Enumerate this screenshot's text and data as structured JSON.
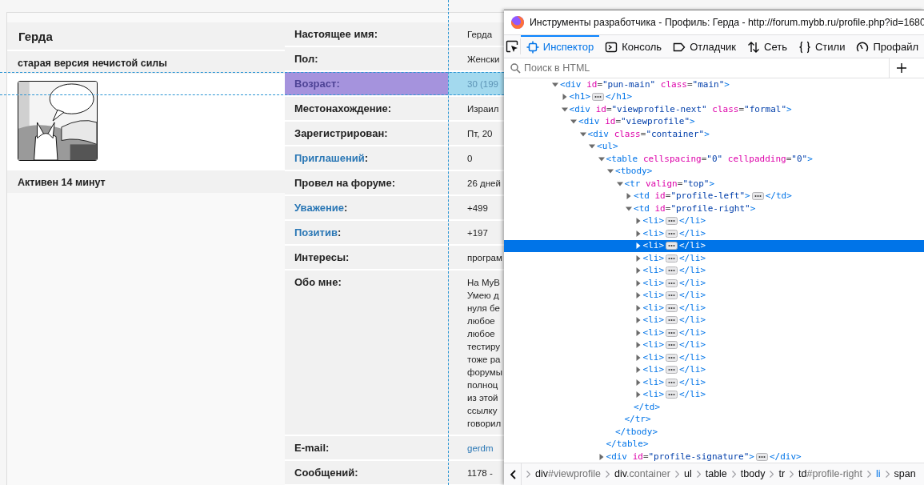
{
  "profile": {
    "username": "Герда",
    "user_title": "старая версия нечистой силы",
    "activity": "Активен 14 минут",
    "fields": [
      {
        "label": "Настоящее имя:",
        "link": false,
        "value": "Герда",
        "value_link": false,
        "highlighted": false
      },
      {
        "label": "Пол:",
        "link": false,
        "value": "Женски",
        "value_link": false,
        "highlighted": false
      },
      {
        "label": "Возраст:",
        "link": false,
        "value": "30 (199",
        "value_link": false,
        "highlighted": true
      },
      {
        "label": "Местонахождение:",
        "link": false,
        "value": "Израил",
        "value_link": false,
        "highlighted": false
      },
      {
        "label": "Зарегистрирован:",
        "link": false,
        "value": "Пт, 20",
        "value_link": false,
        "highlighted": false
      },
      {
        "label": "Приглашений",
        "after": ":",
        "link": true,
        "value": "0",
        "value_link": false,
        "highlighted": false
      },
      {
        "label": "Провел на форуме:",
        "link": false,
        "value": "26 дней",
        "value_link": false,
        "highlighted": false
      },
      {
        "label": "Уважение",
        "after": ":",
        "link": true,
        "value": "+499",
        "value_link": false,
        "highlighted": false
      },
      {
        "label": "Позитив",
        "after": ":",
        "link": true,
        "value": "+197",
        "value_link": false,
        "highlighted": false
      },
      {
        "label": "Интересы:",
        "link": false,
        "value": "програм",
        "value_link": false,
        "highlighted": false
      },
      {
        "label": "Обо мне:",
        "link": false,
        "lines": [
          "На MyB",
          "Умею д",
          "нуля бе",
          "любое",
          "любое",
          "тестиру",
          "тоже ра",
          "форумы",
          "полноц",
          "из этой",
          "ссылку",
          "говорил"
        ],
        "value_link": false,
        "highlighted": false
      },
      {
        "label": "E-mail:",
        "link": false,
        "value": "gerdm",
        "value_link": true,
        "highlighted": false
      },
      {
        "label": "Сообщений:",
        "link": false,
        "value": "1178 -",
        "value_link": false,
        "highlighted": false
      }
    ]
  },
  "devtools": {
    "title": "Инструменты разработчика - Профиль: Герда - http://forum.mybb.ru/profile.php?id=1680",
    "tabs": [
      {
        "label": "Инспектор",
        "kind": "inspector",
        "selected": true
      },
      {
        "label": "Консоль",
        "kind": "console",
        "selected": false
      },
      {
        "label": "Отладчик",
        "kind": "debugger",
        "selected": false
      },
      {
        "label": "Сеть",
        "kind": "network",
        "selected": false
      },
      {
        "label": "Стили",
        "kind": "style",
        "selected": false
      },
      {
        "label": "Профайл",
        "kind": "performance",
        "selected": false
      }
    ],
    "search": {
      "placeholder": "Поиск в HTML"
    },
    "tree": [
      {
        "open": "<div id=\"pun-main\" class=\"main\">",
        "expanded": true,
        "selected": false,
        "children": [
          {
            "open": "<h1>",
            "close": "</h1>",
            "expanded": false,
            "selected": false
          },
          {
            "open": "<div id=\"viewprofile-next\" class=\"formal\">",
            "expanded": true,
            "selected": false,
            "children": [
              {
                "open": "<div id=\"viewprofile\">",
                "expanded": true,
                "selected": false,
                "children": [
                  {
                    "open": "<div class=\"container\">",
                    "expanded": true,
                    "selected": false,
                    "children": [
                      {
                        "open": "<ul>",
                        "expanded": true,
                        "selected": false,
                        "children": [
                          {
                            "open": "<table cellspacing=\"0\" cellpadding=\"0\">",
                            "close": "</table>",
                            "expanded": true,
                            "selected": false,
                            "children": [
                              {
                                "open": "<tbody>",
                                "close": "</tbody>",
                                "expanded": true,
                                "selected": false,
                                "children": [
                                  {
                                    "open": "<tr valign=\"top\">",
                                    "close": "</tr>",
                                    "expanded": true,
                                    "selected": false,
                                    "children": [
                                      {
                                        "open": "<td id=\"profile-left\">",
                                        "close": "</td>",
                                        "expanded": false,
                                        "selected": false
                                      },
                                      {
                                        "open": "<td id=\"profile-right\">",
                                        "close": "</td>",
                                        "expanded": true,
                                        "selected": false,
                                        "children": [
                                          {
                                            "open": "<li>",
                                            "close": "</li>",
                                            "expanded": false,
                                            "selected": false
                                          },
                                          {
                                            "open": "<li>",
                                            "close": "</li>",
                                            "expanded": false,
                                            "selected": false
                                          },
                                          {
                                            "open": "<li>",
                                            "close": "</li>",
                                            "expanded": false,
                                            "selected": true
                                          },
                                          {
                                            "open": "<li>",
                                            "close": "</li>",
                                            "expanded": false,
                                            "selected": false
                                          },
                                          {
                                            "open": "<li>",
                                            "close": "</li>",
                                            "expanded": false,
                                            "selected": false
                                          },
                                          {
                                            "open": "<li>",
                                            "close": "</li>",
                                            "expanded": false,
                                            "selected": false
                                          },
                                          {
                                            "open": "<li>",
                                            "close": "</li>",
                                            "expanded": false,
                                            "selected": false
                                          },
                                          {
                                            "open": "<li>",
                                            "close": "</li>",
                                            "expanded": false,
                                            "selected": false
                                          },
                                          {
                                            "open": "<li>",
                                            "close": "</li>",
                                            "expanded": false,
                                            "selected": false
                                          },
                                          {
                                            "open": "<li>",
                                            "close": "</li>",
                                            "expanded": false,
                                            "selected": false
                                          },
                                          {
                                            "open": "<li>",
                                            "close": "</li>",
                                            "expanded": false,
                                            "selected": false
                                          },
                                          {
                                            "open": "<li>",
                                            "close": "</li>",
                                            "expanded": false,
                                            "selected": false
                                          },
                                          {
                                            "open": "<li>",
                                            "close": "</li>",
                                            "expanded": false,
                                            "selected": false
                                          },
                                          {
                                            "open": "<li>",
                                            "close": "</li>",
                                            "expanded": false,
                                            "selected": false
                                          },
                                          {
                                            "open": "<li>",
                                            "close": "</li>",
                                            "expanded": false,
                                            "selected": false
                                          }
                                        ]
                                      }
                                    ]
                                  }
                                ]
                              }
                            ]
                          },
                          {
                            "open": "<div id=\"profile-signature\">",
                            "close": "</div>",
                            "expanded": false,
                            "selected": false
                          }
                        ]
                      }
                    ]
                  }
                ]
              }
            ]
          }
        ]
      }
    ],
    "breadcrumbs": [
      {
        "tag": "div",
        "suffix": "#viewprofile",
        "selected": false
      },
      {
        "tag": "div",
        "suffix": ".container",
        "selected": false
      },
      {
        "tag": "ul",
        "selected": false
      },
      {
        "tag": "table",
        "selected": false
      },
      {
        "tag": "tbody",
        "selected": false
      },
      {
        "tag": "tr",
        "selected": false
      },
      {
        "tag": "td",
        "suffix": "#profile-right",
        "selected": false
      },
      {
        "tag": "li",
        "selected": true
      },
      {
        "tag": "span",
        "selected": false
      }
    ]
  }
}
